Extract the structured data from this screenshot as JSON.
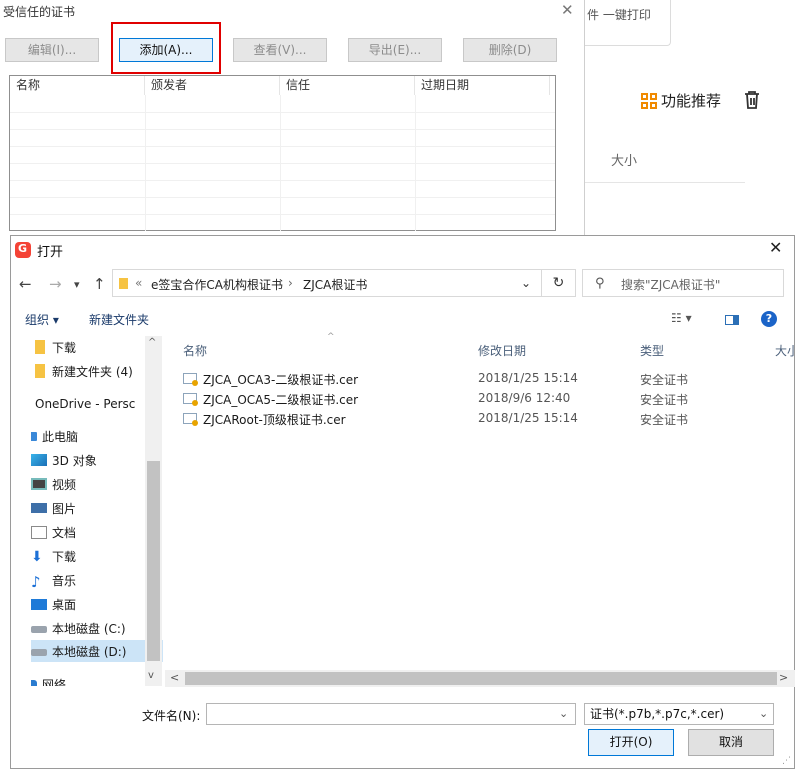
{
  "background_app": {
    "card_text": "件 一键打印",
    "feature_label": "功能推荐",
    "column_size": "大小"
  },
  "cert_dialog": {
    "title": "受信任的证书",
    "close": "✕",
    "buttons": {
      "edit": "编辑(I)...",
      "add": "添加(A)...",
      "view": "查看(V)...",
      "export": "导出(E)...",
      "delete": "删除(D)"
    },
    "columns": [
      "名称",
      "颁发者",
      "信任",
      "过期日期"
    ]
  },
  "open_dialog": {
    "title": "打开",
    "close": "✕",
    "nav": {
      "back": "←",
      "forward": "→",
      "recent": "▾",
      "up": "↑"
    },
    "address": {
      "sep": "«",
      "path1": "e签宝合作CA机构根证书",
      "gt": "›",
      "path2": "ZJCA根证书",
      "dropdown": "⌄"
    },
    "refresh": "↻",
    "search_placeholder": "搜索\"ZJCA根证书\"",
    "toolbar": {
      "organize": "组织 ▾",
      "new_folder": "新建文件夹",
      "view": "☷ ▾",
      "help": "?"
    },
    "sidebar": [
      {
        "label": "下载",
        "icon": "folder-icon"
      },
      {
        "label": "新建文件夹 (4)",
        "icon": "folder-icon"
      },
      {
        "label": "OneDrive - Persc",
        "icon": "onedrive-icon"
      },
      {
        "label": "此电脑",
        "icon": "pc-icon"
      },
      {
        "label": "3D 对象",
        "icon": "3d-objects-icon"
      },
      {
        "label": "视频",
        "icon": "video-icon"
      },
      {
        "label": "图片",
        "icon": "pictures-icon"
      },
      {
        "label": "文档",
        "icon": "documents-icon"
      },
      {
        "label": "下载",
        "icon": "downloads-icon"
      },
      {
        "label": "音乐",
        "icon": "music-icon"
      },
      {
        "label": "桌面",
        "icon": "desktop-icon"
      },
      {
        "label": "本地磁盘 (C:)",
        "icon": "drive-icon"
      },
      {
        "label": "本地磁盘 (D:)",
        "icon": "drive-icon",
        "selected": true
      },
      {
        "label": "网络",
        "icon": "network-icon"
      }
    ],
    "file_headers": {
      "name": "名称",
      "date": "修改日期",
      "type": "类型",
      "size": "大小"
    },
    "files": [
      {
        "name": "ZJCA_OCA3-二级根证书.cer",
        "date": "2018/1/25 15:14",
        "type": "安全证书"
      },
      {
        "name": "ZJCA_OCA5-二级根证书.cer",
        "date": "2018/9/6 12:40",
        "type": "安全证书"
      },
      {
        "name": "ZJCARoot-顶级根证书.cer",
        "date": "2018/1/25 15:14",
        "type": "安全证书"
      }
    ],
    "filename_label": "文件名(N):",
    "filename_value": "",
    "filetype_value": "证书(*.p7b,*.p7c,*.cer)",
    "open_button": "打开(O)",
    "cancel_button": "取消"
  }
}
